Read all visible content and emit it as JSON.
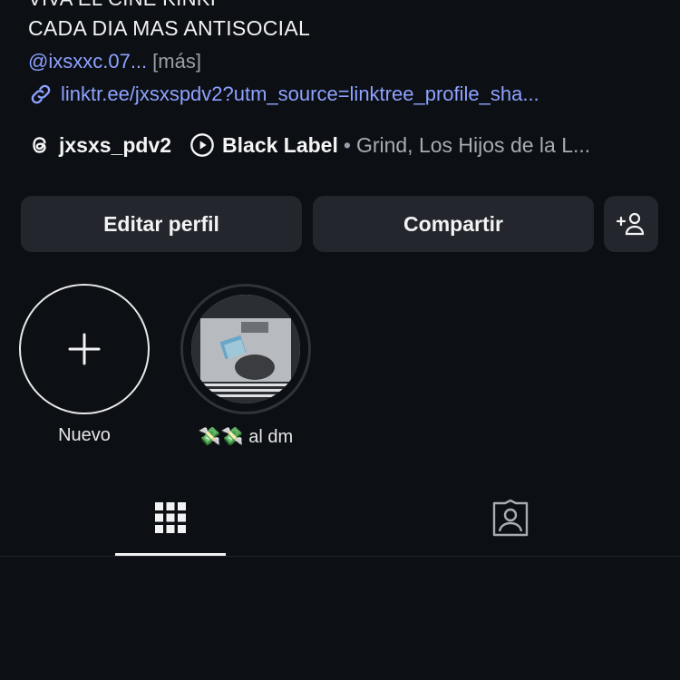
{
  "profile": {
    "bio_line_1_partial": "VIVA EL CINE KINKI",
    "bio_line_2": "CADA DIA MAS ANTISOCIAL",
    "mention": "@ixsxxc.07",
    "mention_ellipsis": "...",
    "more_label": "[más]",
    "link": "linktr.ee/jxsxspdv2?utm_source=linktree_profile_sha...",
    "threads_handle": "jxsxs_pdv2",
    "music_title": "Black Label",
    "music_separator": "•",
    "music_artists": "Grind, Los Hijos de la L..."
  },
  "buttons": {
    "edit_profile": "Editar perfil",
    "share": "Compartir"
  },
  "highlights": [
    {
      "label": "Nuevo",
      "icon": "plus-icon"
    },
    {
      "label": "💸💸 al dm"
    }
  ],
  "tabs": [
    {
      "name": "posts",
      "icon": "grid-icon",
      "active": true
    },
    {
      "name": "tagged",
      "icon": "tagged-person-icon",
      "active": false
    }
  ],
  "colors": {
    "background": "#0c0f14",
    "button_bg": "#23262d",
    "link": "#8ea2ff",
    "muted": "#a7acb3"
  }
}
